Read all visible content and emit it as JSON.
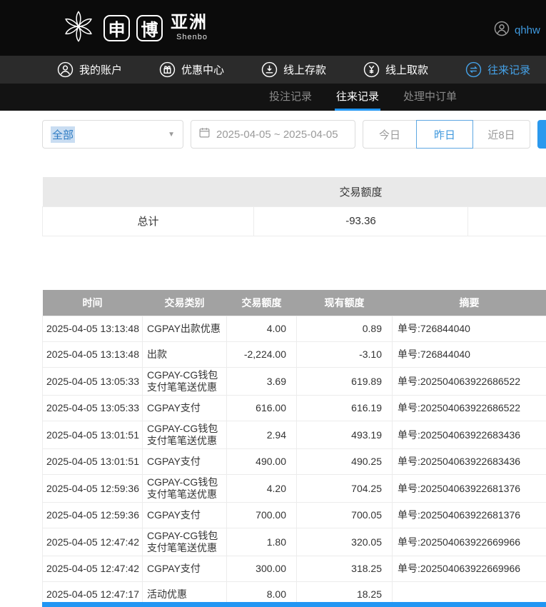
{
  "brand": {
    "logo_char_1": "申",
    "logo_char_2": "博",
    "logo_region": "亚洲",
    "logo_sub": "Shenbo"
  },
  "account": {
    "username": "qhhw"
  },
  "nav": {
    "items": [
      {
        "label": "我的账户",
        "icon": "user-circle-icon",
        "active": false
      },
      {
        "label": "优惠中心",
        "icon": "gift-circle-icon",
        "active": false
      },
      {
        "label": "线上存款",
        "icon": "deposit-circle-icon",
        "active": false
      },
      {
        "label": "线上取款",
        "icon": "withdraw-circle-icon",
        "active": false
      },
      {
        "label": "往来记录",
        "icon": "records-circle-icon",
        "active": true
      }
    ]
  },
  "subnav": {
    "tabs": [
      {
        "label": "投注记录",
        "active": false
      },
      {
        "label": "往来记录",
        "active": true
      },
      {
        "label": "处理中订单",
        "active": false
      }
    ]
  },
  "filters": {
    "type_selected": "全部",
    "date_range": "2025-04-05 ~ 2025-04-05",
    "quick": [
      "今日",
      "昨日",
      "近8日"
    ],
    "active_quick": "昨日"
  },
  "summary": {
    "amount_header": "交易额度",
    "total_label": "总计",
    "total_value": "-93.36"
  },
  "table": {
    "columns": [
      "时间",
      "交易类别",
      "交易额度",
      "现有额度",
      "摘要"
    ],
    "rows": [
      [
        "2025-04-05 13:13:48",
        "CGPAY出款优惠",
        "4.00",
        "0.89",
        "单号:726844040"
      ],
      [
        "2025-04-05 13:13:48",
        "出款",
        "-2,224.00",
        "-3.10",
        "单号:726844040"
      ],
      [
        "2025-04-05 13:05:33",
        "CGPAY-CG钱包支付笔笔送优惠",
        "3.69",
        "619.89",
        "单号:202504063922686522"
      ],
      [
        "2025-04-05 13:05:33",
        "CGPAY支付",
        "616.00",
        "616.19",
        "单号:202504063922686522"
      ],
      [
        "2025-04-05 13:01:51",
        "CGPAY-CG钱包支付笔笔送优惠",
        "2.94",
        "493.19",
        "单号:202504063922683436"
      ],
      [
        "2025-04-05 13:01:51",
        "CGPAY支付",
        "490.00",
        "490.25",
        "单号:202504063922683436"
      ],
      [
        "2025-04-05 12:59:36",
        "CGPAY-CG钱包支付笔笔送优惠",
        "4.20",
        "704.25",
        "单号:202504063922681376"
      ],
      [
        "2025-04-05 12:59:36",
        "CGPAY支付",
        "700.00",
        "700.05",
        "单号:202504063922681376"
      ],
      [
        "2025-04-05 12:47:42",
        "CGPAY-CG钱包支付笔笔送优惠",
        "1.80",
        "320.05",
        "单号:202504063922669966"
      ],
      [
        "2025-04-05 12:47:42",
        "CGPAY支付",
        "300.00",
        "318.25",
        "单号:202504063922669966"
      ],
      [
        "2025-04-05 12:47:17",
        "活动优惠",
        "8.00",
        "18.25",
        ""
      ]
    ]
  },
  "colors": {
    "accent": "#2196f3",
    "nav_active": "#45a2e8",
    "table_header_bg": "#a2a2a2",
    "summary_header_bg": "#e9e9e9"
  }
}
